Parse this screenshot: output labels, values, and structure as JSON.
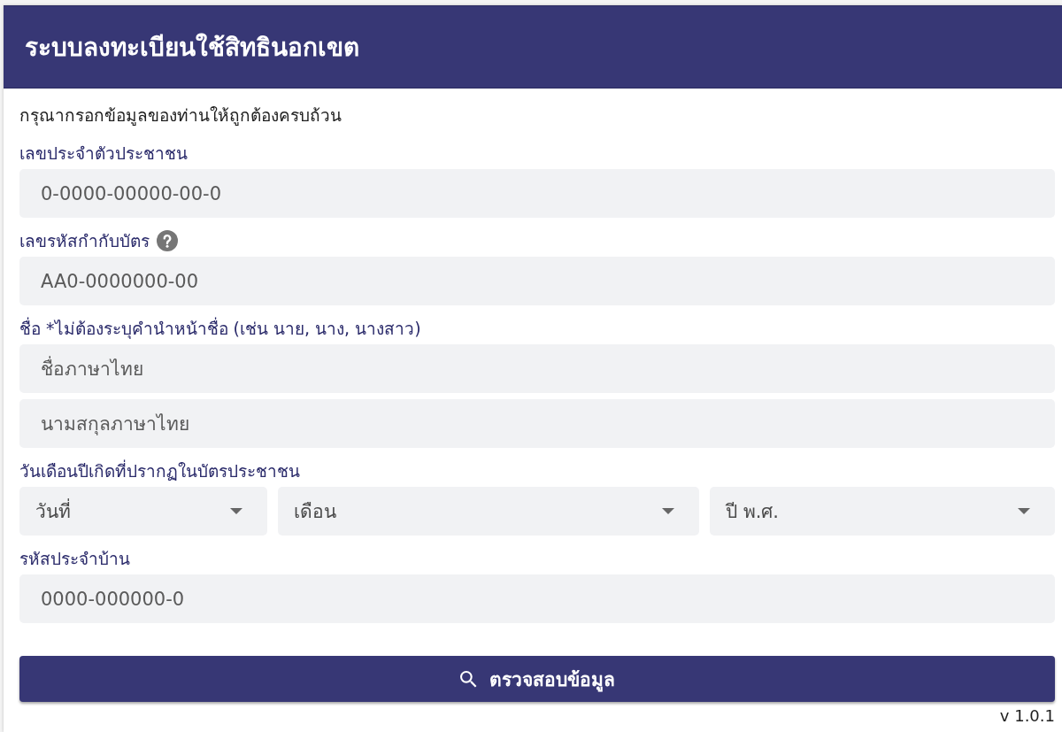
{
  "header": {
    "title": "ระบบลงทะเบียนใช้สิทธินอกเขต"
  },
  "form": {
    "instruction": "กรุณากรอกข้อมูลของท่านให้ถูกต้องครบถ้วน",
    "groups": [
      {
        "label": "เลขประจำตัวประชาชน",
        "help": false,
        "fields": [
          {
            "kind": "text",
            "placeholder": "0-0000-00000-00-0"
          }
        ]
      },
      {
        "label": "เลขรหัสกำกับบัตร",
        "help": true,
        "fields": [
          {
            "kind": "text",
            "placeholder": "AA0-0000000-00"
          }
        ]
      },
      {
        "label": "ชื่อ *ไม่ต้องระบุคำนำหน้าชื่อ (เช่น นาย, นาง, นางสาว)",
        "help": false,
        "fields": [
          {
            "kind": "text",
            "placeholder": "ชื่อภาษาไทย"
          },
          {
            "kind": "text",
            "placeholder": "นามสกุลภาษาไทย"
          }
        ]
      },
      {
        "label": "วันเดือนปีเกิดที่ปรากฏในบัตรประชาชน",
        "help": false,
        "fields": [
          {
            "kind": "select",
            "placeholder": "วันที่"
          },
          {
            "kind": "select",
            "placeholder": "เดือน"
          },
          {
            "kind": "select",
            "placeholder": "ปี พ.ศ."
          }
        ]
      },
      {
        "label": "รหัสประจำบ้าน",
        "help": false,
        "fields": [
          {
            "kind": "text",
            "placeholder": "0000-000000-0"
          }
        ]
      }
    ],
    "submit_button": {
      "label": "ตรวจสอบข้อมูล"
    }
  },
  "version": "v 1.0.1"
}
